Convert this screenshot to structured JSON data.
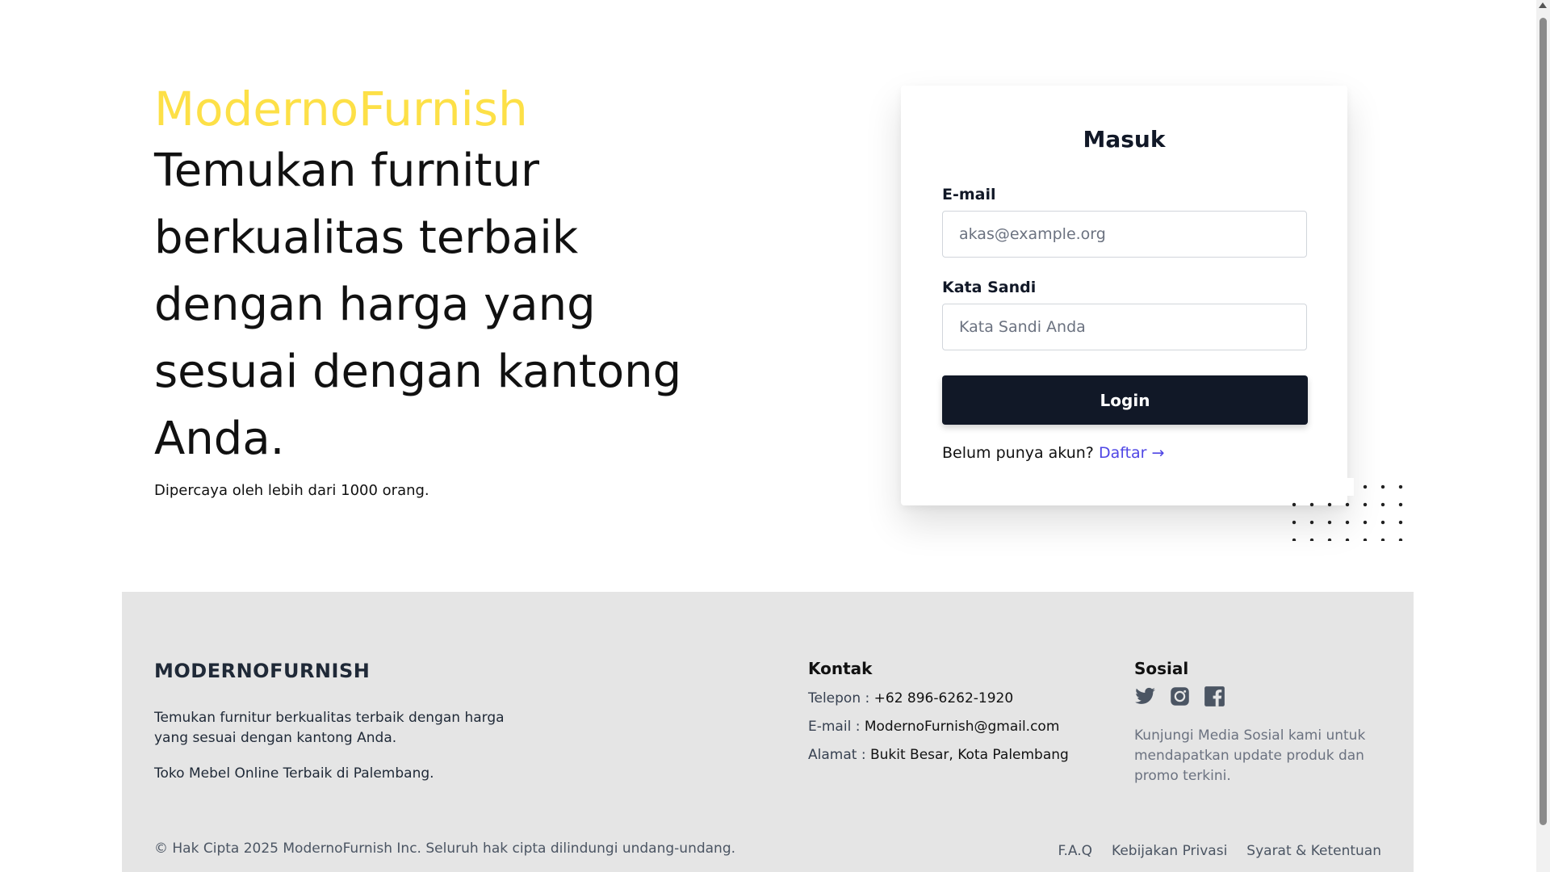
{
  "hero": {
    "brand": "ModernoFurnish",
    "headline": "Temukan furnitur berkualitas terbaik dengan harga yang sesuai dengan kantong Anda.",
    "trust": "Dipercaya oleh lebih dari 1000 orang."
  },
  "login": {
    "title": "Masuk",
    "email_label": "E-mail",
    "email_placeholder": "akas@example.org",
    "password_label": "Kata Sandi",
    "password_placeholder": "Kata Sandi Anda",
    "button": "Login",
    "no_account": "Belum punya akun?",
    "register_link": "Daftar →"
  },
  "footer": {
    "brand": "MODERNOFURNISH",
    "description": "Temukan furnitur berkualitas terbaik dengan harga yang sesuai dengan kantong Anda.",
    "tagline": "Toko Mebel Online Terbaik di Palembang.",
    "contact": {
      "heading": "Kontak",
      "phone_label": "Telepon :",
      "phone": "+62 896-6262-1920",
      "email_label": "E-mail :",
      "email": "ModernoFurnish@gmail.com",
      "address_label": "Alamat :",
      "address": "Bukit Besar, Kota Palembang"
    },
    "social": {
      "heading": "Sosial",
      "icons": [
        "twitter-icon",
        "instagram-icon",
        "facebook-icon"
      ],
      "note": "Kunjungi Media Sosial kami untuk mendapatkan update produk dan promo terkini."
    },
    "copyright": "© Hak Cipta 2025 ModernoFurnish Inc. Seluruh hak cipta dilindungi undang-undang.",
    "links": [
      "F.A.Q",
      "Kebijakan Privasi",
      "Syarat & Ketentuan"
    ]
  },
  "colors": {
    "brand_yellow": "#fde047",
    "button_dark": "#111827",
    "link_indigo": "#4f46e5",
    "footer_bg": "#e5e5e5"
  }
}
